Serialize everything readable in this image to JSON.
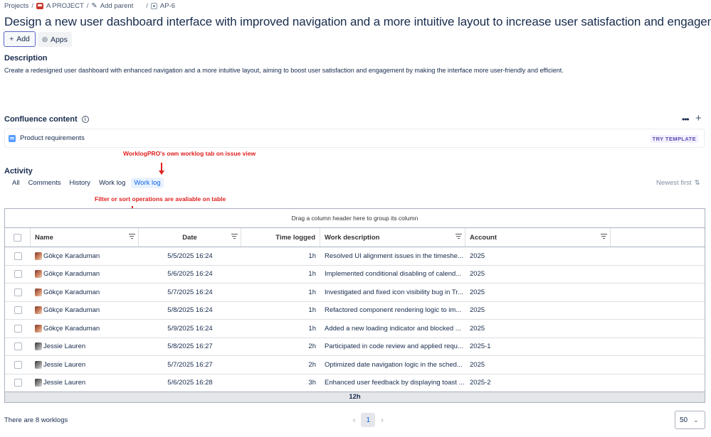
{
  "breadcrumb": {
    "projects": "Projects",
    "project": "A PROJECT",
    "add_parent": "Add parent",
    "issue_key": "AP-6",
    "sep": "/"
  },
  "issue": {
    "title": "Design a new user dashboard interface with improved navigation and a more intuitive layout to increase user satisfaction and engagement."
  },
  "actions": {
    "add": "Add",
    "apps": "Apps"
  },
  "description": {
    "heading": "Description",
    "text": "Create a redesigned user dashboard with enhanced navigation and a more intuitive layout, aiming to boost user satisfaction and engagement by making the interface more user-friendly and efficient."
  },
  "confluence": {
    "heading": "Confluence content",
    "item": "Product requirements",
    "try_template": "TRY TEMPLATE"
  },
  "annotations": {
    "worklog_tab": "WorklogPRO's own worklog tab on issue view",
    "filter_sort": "Filter or sort operations are avaliable on table"
  },
  "activity": {
    "heading": "Activity",
    "tabs": [
      "All",
      "Comments",
      "History",
      "Work log",
      "Work log"
    ],
    "active_tab_index": 4,
    "sort": "Newest first"
  },
  "table": {
    "group_hint": "Drag a column header here to group its column",
    "columns": [
      "Name",
      "Date",
      "Time logged",
      "Work description",
      "Account"
    ],
    "rows": [
      {
        "name": "Gökçe Karaduman",
        "date": "5/5/2025 16:24",
        "time": "1h",
        "desc": "Resolved UI alignment issues in the timeshe...",
        "account": "2025"
      },
      {
        "name": "Gökçe Karaduman",
        "date": "5/6/2025 16:24",
        "time": "1h",
        "desc": "Implemented conditional disabling of calend...",
        "account": "2025"
      },
      {
        "name": "Gökçe Karaduman",
        "date": "5/7/2025 16:24",
        "time": "1h",
        "desc": "Investigated and fixed icon visibility bug in Tr...",
        "account": "2025"
      },
      {
        "name": "Gökçe Karaduman",
        "date": "5/8/2025 16:24",
        "time": "1h",
        "desc": "Refactored component rendering logic to im...",
        "account": "2025"
      },
      {
        "name": "Gökçe Karaduman",
        "date": "5/9/2025 16:24",
        "time": "1h",
        "desc": "Added a new loading indicator and blocked ...",
        "account": "2025"
      },
      {
        "name": "Jessie Lauren",
        "date": "5/8/2025 16:27",
        "time": "2h",
        "desc": "Participated in code review and applied requ...",
        "account": "2025-1"
      },
      {
        "name": "Jessie Lauren",
        "date": "5/7/2025 16:27",
        "time": "2h",
        "desc": "Optimized date navigation logic in the sched...",
        "account": "2025"
      },
      {
        "name": "Jessie Lauren",
        "date": "5/6/2025 16:28",
        "time": "3h",
        "desc": "Enhanced user feedback by displaying toast ...",
        "account": "2025-2"
      }
    ],
    "total": "12h"
  },
  "pagination": {
    "count_text": "There are 8 worklogs",
    "current_page": "1",
    "page_size": "50"
  }
}
